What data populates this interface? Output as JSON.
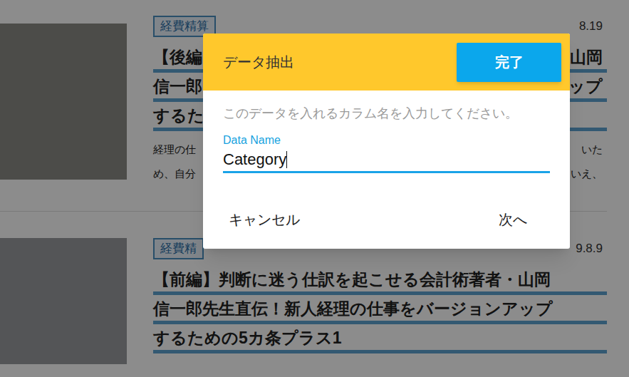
{
  "articles": [
    {
      "category": "経費精算",
      "date": "8.19",
      "title_lines": [
        {
          "left": "【後編",
          "right": "山岡"
        },
        {
          "left": "信一郎",
          "right": "ップ"
        },
        {
          "left": "するた"
        }
      ],
      "excerpt_lines": [
        {
          "left": "経理の仕",
          "right": "いた"
        },
        {
          "left": "め、自分",
          "right": "いえ、"
        }
      ]
    },
    {
      "category": "経費精",
      "date": "9.8.9",
      "title_lines": [
        {
          "left": "【前編】判断に迷う仕訳を起こせる会計術著者・山岡"
        },
        {
          "left": "信一郎先生直伝！新人経理の仕事をバージョンアップ"
        },
        {
          "left": "するための5カ条プラス1"
        }
      ],
      "excerpt_lines": []
    }
  ],
  "dialog": {
    "title": "データ抽出",
    "done_button": "完了",
    "prompt": "このデータを入れるカラム名を入力してください。",
    "field": {
      "label": "Data Name",
      "value": "Category",
      "focused": true
    },
    "cancel_button": "キャンセル",
    "next_button": "次へ"
  }
}
